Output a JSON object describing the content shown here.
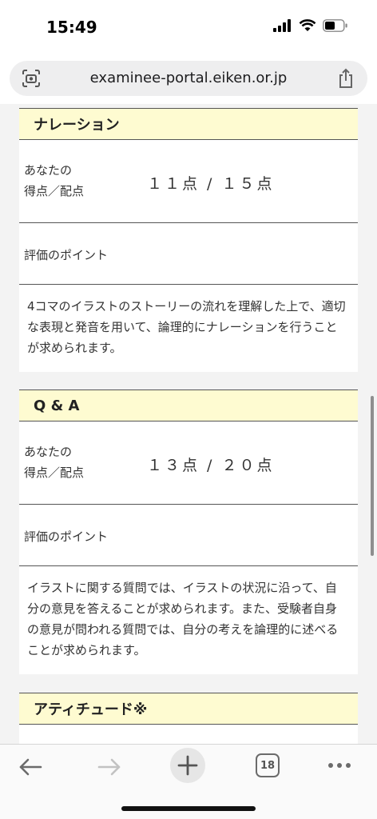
{
  "status": {
    "time": "15:49"
  },
  "browser": {
    "url": "examinee-portal.eiken.or.jp",
    "tab_count": "18"
  },
  "sections": [
    {
      "title": "ナレーション",
      "score_label_line1": "あなたの",
      "score_label_line2": "得点／配点",
      "score": "１１点 / １５点",
      "point_label": "評価のポイント",
      "description": "4コマのイラストのストーリーの流れを理解した上で、適切な表現と発音を用いて、論理的にナレーションを行うことが求められます。"
    },
    {
      "title": "Q & A",
      "score_label_line1": "あなたの",
      "score_label_line2": "得点／配点",
      "score": "１３点 / ２０点",
      "point_label": "評価のポイント",
      "description": "イラストに関する質問では、イラストの状況に沿って、自分の意見を答えることが求められます。また、受験者自身の意見が問われる質問では、自分の考えを論理的に述べることが求められます。"
    },
    {
      "title": "アティチュード※"
    }
  ],
  "icons": {
    "left_url": "page-settings-icon",
    "share": "share-icon",
    "back": "back-arrow-icon",
    "forward": "forward-arrow-icon",
    "new_tab": "plus-icon",
    "tabs": "tabs-icon",
    "more": "more-icon"
  },
  "colors": {
    "header_bg": "#fefbd1",
    "page_bg": "#f3f3f3"
  }
}
